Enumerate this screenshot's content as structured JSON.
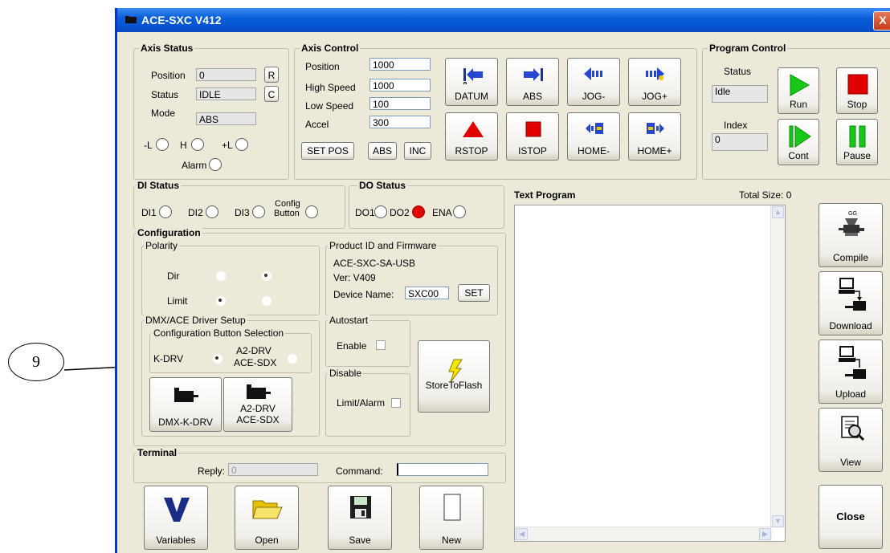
{
  "window": {
    "title": "ACE-SXC V412",
    "close_glyph": "X"
  },
  "axis_status": {
    "title": "Axis Status",
    "position_label": "Position",
    "position_value": "0",
    "r_button": "R",
    "status_label": "Status",
    "status_value": "IDLE",
    "c_button": "C",
    "mode_label": "Mode",
    "mode_value": "ABS",
    "limit_minus": "-L",
    "home": "H",
    "limit_plus": "+L",
    "alarm": "Alarm"
  },
  "axis_control": {
    "title": "Axis Control",
    "position_label": "Position",
    "position_value": "1000",
    "high_speed_label": "High Speed",
    "high_speed_value": "1000",
    "low_speed_label": "Low Speed",
    "low_speed_value": "100",
    "accel_label": "Accel",
    "accel_value": "300",
    "set_pos": "SET POS",
    "abs": "ABS",
    "inc": "INC",
    "datum": "DATUM",
    "abs_move": "ABS",
    "jog_minus": "JOG-",
    "jog_plus": "JOG+",
    "rstop": "RSTOP",
    "istop": "ISTOP",
    "home_minus": "HOME-",
    "home_plus": "HOME+"
  },
  "program_control": {
    "title": "Program Control",
    "status_label": "Status",
    "status_value": "Idle",
    "index_label": "Index",
    "index_value": "0",
    "run": "Run",
    "stop": "Stop",
    "cont": "Cont",
    "pause": "Pause"
  },
  "di_status": {
    "title": "DI Status",
    "di1": "DI1",
    "di2": "DI2",
    "di3": "DI3",
    "config_button_1": "Config",
    "config_button_2": "Button"
  },
  "do_status": {
    "title": "DO Status",
    "do1": "DO1",
    "do2": "DO2",
    "ena": "ENA",
    "do2_color": "#e00000"
  },
  "configuration": {
    "title": "Configuration",
    "polarity_title": "Polarity",
    "dir_label": "Dir",
    "limit_label": "Limit",
    "product_title": "Product ID and Firmware",
    "product_id": "ACE-SXC-SA-USB",
    "version": "Ver: V409",
    "device_name_label": "Device Name:",
    "device_name_value": "SXC00",
    "set_button": "SET",
    "driver_setup_title": "DMX/ACE Driver Setup",
    "config_button_selection": "Configuration Button Selection",
    "kdrv_label": "K-DRV",
    "a2drv_label_1": "A2-DRV",
    "a2drv_label_2": "ACE-SDX",
    "autostart_title": "Autostart",
    "enable_label": "Enable",
    "disable_title": "Disable",
    "limit_alarm_label": "Limit/Alarm",
    "store_to_flash": "StoreToFlash",
    "dmx_k_drv_button": "DMX-K-DRV",
    "a2_drv_button_1": "A2-DRV",
    "a2_drv_button_2": "ACE-SDX"
  },
  "terminal": {
    "title": "Terminal",
    "reply_label": "Reply:",
    "reply_value": "0",
    "command_label": "Command:",
    "command_value": ""
  },
  "bottom_buttons": {
    "variables": "Variables",
    "open": "Open",
    "save": "Save",
    "new": "New"
  },
  "text_program": {
    "title": "Text Program",
    "total_size": "Total Size: 0"
  },
  "side_buttons": {
    "compile": "Compile",
    "download": "Download",
    "upload": "Upload",
    "view": "View",
    "close": "Close"
  },
  "annotation": {
    "callout_number": "9"
  }
}
